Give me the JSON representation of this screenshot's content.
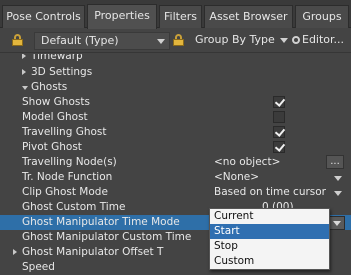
{
  "tabs": [
    {
      "label": "Pose Controls",
      "active": false
    },
    {
      "label": "Properties",
      "active": true
    },
    {
      "label": "Filters",
      "active": false
    },
    {
      "label": "Asset Browser",
      "active": false
    },
    {
      "label": "Groups",
      "active": false
    }
  ],
  "toolbar": {
    "type_combo": "Default (Type)",
    "group_combo": "Group By Type",
    "editor_label": "Editor..."
  },
  "tree": {
    "rows": [
      {
        "label": "Timewarp",
        "expander": "right"
      },
      {
        "label": "3D Settings",
        "expander": "right"
      },
      {
        "label": "Ghosts",
        "expander": "down"
      },
      {
        "label": "Show Ghosts",
        "checkbox": true
      },
      {
        "label": "Model Ghost",
        "checkbox": false
      },
      {
        "label": "Travelling Ghost",
        "checkbox": true
      },
      {
        "label": "Pivot Ghost",
        "checkbox": true
      },
      {
        "label": "Travelling Node(s)",
        "value": "<no object>",
        "button": "..."
      },
      {
        "label": "Tr. Node Function",
        "value": "<None>"
      },
      {
        "label": "Clip Ghost Mode",
        "value": "Based on time cursor"
      },
      {
        "label": "Ghost Custom Time",
        "value": "0 (00)"
      },
      {
        "label": "Ghost Manipulator Time Mode",
        "value": ""
      },
      {
        "label": "Ghost Manipulator Custom Time",
        "value": ""
      },
      {
        "label": "Ghost Manipulator Offset T",
        "value": ""
      },
      {
        "label": "Speed",
        "value": ""
      }
    ]
  },
  "dropdown": {
    "options": [
      "Current",
      "Start",
      "Stop",
      "Custom"
    ],
    "selected": "Start"
  }
}
